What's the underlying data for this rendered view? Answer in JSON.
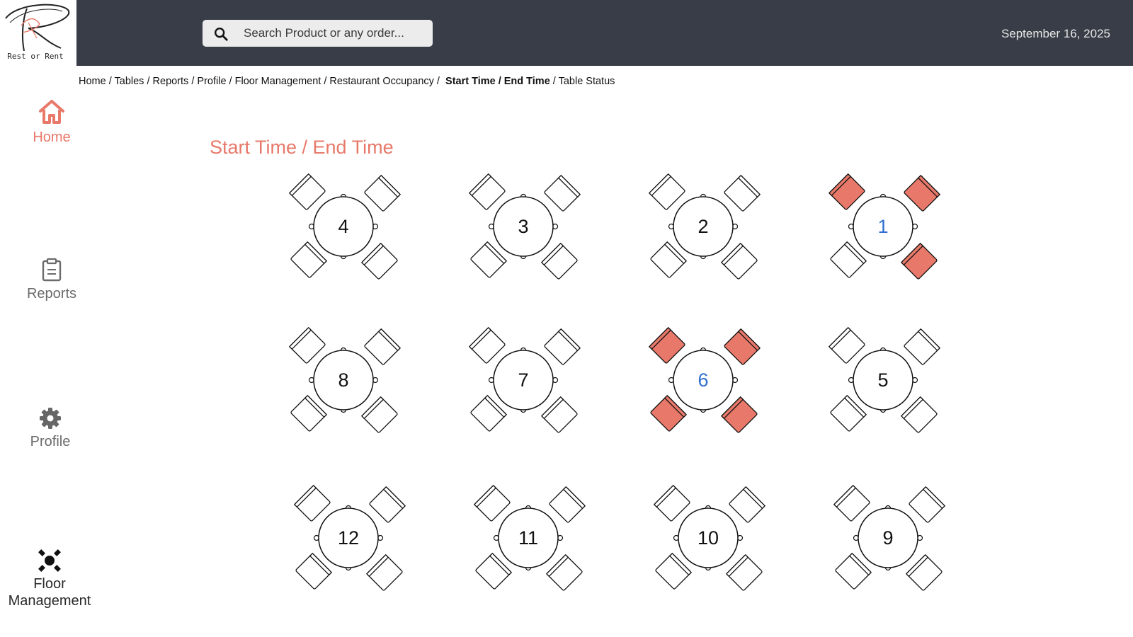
{
  "app": {
    "logo_text": "Rest or Rent"
  },
  "search": {
    "placeholder": "Search Product or any order..."
  },
  "header": {
    "date": "September 16, 2025"
  },
  "breadcrumb": {
    "items": [
      "Home",
      "Tables",
      "Reports",
      "Profile",
      "Floor Management",
      "Restaurant Occupancy"
    ],
    "current": "Start Time / End Time",
    "last": "Table Status"
  },
  "sidebar": {
    "home": "Home",
    "reports": "Reports",
    "profile": "Profile",
    "floor_line1": "Floor",
    "floor_line2": "Management"
  },
  "page": {
    "title": "Start Time / End Time"
  },
  "colors": {
    "accent": "#e8796a",
    "header_bg": "#393d47",
    "busy_number": "#2f6fd0"
  },
  "tables": [
    {
      "number": "4",
      "chairs": [
        false,
        false,
        false,
        false
      ]
    },
    {
      "number": "3",
      "chairs": [
        false,
        false,
        false,
        false
      ]
    },
    {
      "number": "2",
      "chairs": [
        false,
        false,
        false,
        false
      ]
    },
    {
      "number": "1",
      "chairs": [
        true,
        true,
        false,
        true
      ]
    },
    {
      "number": "8",
      "chairs": [
        false,
        false,
        false,
        false
      ]
    },
    {
      "number": "7",
      "chairs": [
        false,
        false,
        false,
        false
      ]
    },
    {
      "number": "6",
      "chairs": [
        true,
        true,
        true,
        true
      ]
    },
    {
      "number": "5",
      "chairs": [
        false,
        false,
        false,
        false
      ]
    },
    {
      "number": "12",
      "chairs": [
        false,
        false,
        false,
        false
      ]
    },
    {
      "number": "11",
      "chairs": [
        false,
        false,
        false,
        false
      ]
    },
    {
      "number": "10",
      "chairs": [
        false,
        false,
        false,
        false
      ]
    },
    {
      "number": "9",
      "chairs": [
        false,
        false,
        false,
        false
      ]
    }
  ]
}
